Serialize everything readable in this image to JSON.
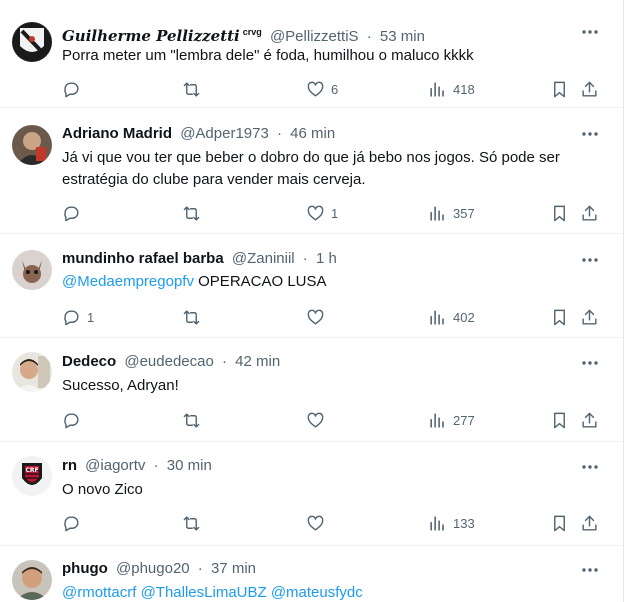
{
  "tweets": [
    {
      "name": "Guilherme Pellizzetti",
      "badge": "crvg",
      "handle": "@PellizzettiS",
      "time": "53 min",
      "text": "Porra meter um \"lembra dele\" é foda, humilhou o maluco kkkk",
      "replies": "",
      "retweets": "",
      "likes": "6",
      "views": "418"
    },
    {
      "name": "Adriano Madrid",
      "handle": "@Adper1973",
      "time": "46 min",
      "text": "Já vi que vou ter que beber o dobro do que já bebo nos jogos. Só pode ser estratégia do clube para vender mais cerveja.",
      "replies": "",
      "retweets": "",
      "likes": "1",
      "views": "357"
    },
    {
      "name": "mundinho rafael barba",
      "handle": "@Zaniniil",
      "time": "1 h",
      "mention": "@Medaempregopfv",
      "text": " OPERACAO LUSA",
      "replies": "1",
      "retweets": "",
      "likes": "",
      "views": "402"
    },
    {
      "name": "Dedeco",
      "handle": "@eudedecao",
      "time": "42 min",
      "text": "Sucesso, Adryan!",
      "replies": "",
      "retweets": "",
      "likes": "",
      "views": "277"
    },
    {
      "name": "rn",
      "handle": "@iagortv",
      "time": "30 min",
      "text": "O novo Zico",
      "replies": "",
      "retweets": "",
      "likes": "",
      "views": "133"
    },
    {
      "name": "phugo",
      "handle": "@phugo20",
      "time": "37 min",
      "mentions": "@rmottacrf @ThallesLimaUBZ @mateusfydc"
    }
  ],
  "separator": "·",
  "colors": {
    "text": "#0f1419",
    "secondary": "#536471",
    "link": "#1d9bf0",
    "divider": "#eff3f4"
  },
  "icons": [
    "more-icon",
    "reply-icon",
    "retweet-icon",
    "like-icon",
    "views-icon",
    "bookmark-icon",
    "share-icon"
  ]
}
